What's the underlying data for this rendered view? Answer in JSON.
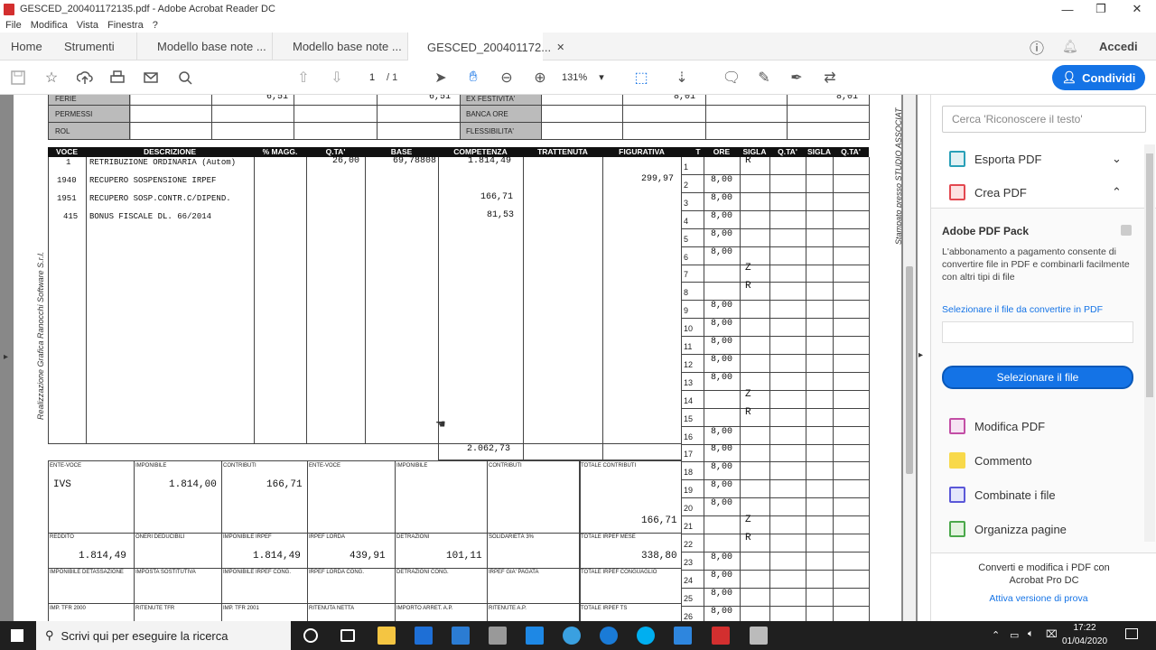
{
  "window": {
    "title": "GESCED_200401172135.pdf - Adobe Acrobat Reader DC"
  },
  "menu": [
    "File",
    "Modifica",
    "Vista",
    "Finestra",
    "?"
  ],
  "tabs": {
    "home": "Home",
    "tools": "Strumenti",
    "docs": [
      "Modello base note ...",
      "Modello base note ...",
      "GESCED_200401172..."
    ],
    "signin": "Accedi"
  },
  "toolbar": {
    "page_current": "1",
    "page_total": "/ 1",
    "zoom": "131%",
    "share": "Condividi"
  },
  "payslip": {
    "top_rows": [
      {
        "label": "FERIE",
        "v1": "6,51",
        "v2": "6,51",
        "label2": "EX FESTIVITA'",
        "v3": "8,01",
        "v4": "8,01"
      },
      {
        "label": "PERMESSI",
        "v1": "",
        "v2": "",
        "label2": "BANCA ORE",
        "v3": "",
        "v4": ""
      },
      {
        "label": "ROL",
        "v1": "",
        "v2": "",
        "label2": "FLESSIBILITA'",
        "v3": "",
        "v4": ""
      }
    ],
    "headers": {
      "voce": "VOCE",
      "descrizione": "DESCRIZIONE",
      "magg": "% MAGG.",
      "qta": "Q.TA'",
      "base": "BASE",
      "competenza": "COMPETENZA",
      "trattenuta": "TRATTENUTA",
      "figurativa": "FIGURATIVA",
      "t": "T",
      "ore": "ORE",
      "sigla": "SIGLA",
      "qta2": "Q.TA'",
      "sigla2": "SIGLA",
      "qta3": "Q.TA'"
    },
    "items": [
      {
        "voce": "1",
        "desc": "RETRIBUZIONE ORDINARIA (Autom)",
        "qta": "26,00",
        "base": "69,78808",
        "comp": "1.814,49",
        "fig": ""
      },
      {
        "voce": "1940",
        "desc": "RECUPERO SOSPENSIONE IRPEF",
        "qta": "",
        "base": "",
        "comp": "",
        "fig": "299,97"
      },
      {
        "voce": "1951",
        "desc": "RECUPERO SOSP.CONTR.C/DIPEND.",
        "qta": "",
        "base": "",
        "comp": "166,71",
        "fig": ""
      },
      {
        "voce": "415",
        "desc": "BONUS FISCALE DL. 66/2014",
        "qta": "",
        "base": "",
        "comp": "81,53",
        "fig": ""
      }
    ],
    "total_competenze": "2.062,73",
    "days": [
      {
        "d": "1",
        "ore": "",
        "sigla": "R"
      },
      {
        "d": "2",
        "ore": "8,00",
        "sigla": ""
      },
      {
        "d": "3",
        "ore": "8,00",
        "sigla": ""
      },
      {
        "d": "4",
        "ore": "8,00",
        "sigla": ""
      },
      {
        "d": "5",
        "ore": "8,00",
        "sigla": ""
      },
      {
        "d": "6",
        "ore": "8,00",
        "sigla": ""
      },
      {
        "d": "7",
        "ore": "",
        "sigla": "Z"
      },
      {
        "d": "8",
        "ore": "",
        "sigla": "R"
      },
      {
        "d": "9",
        "ore": "8,00",
        "sigla": ""
      },
      {
        "d": "10",
        "ore": "8,00",
        "sigla": ""
      },
      {
        "d": "11",
        "ore": "8,00",
        "sigla": ""
      },
      {
        "d": "12",
        "ore": "8,00",
        "sigla": ""
      },
      {
        "d": "13",
        "ore": "8,00",
        "sigla": ""
      },
      {
        "d": "14",
        "ore": "",
        "sigla": "Z"
      },
      {
        "d": "15",
        "ore": "",
        "sigla": "R"
      },
      {
        "d": "16",
        "ore": "8,00",
        "sigla": ""
      },
      {
        "d": "17",
        "ore": "8,00",
        "sigla": ""
      },
      {
        "d": "18",
        "ore": "8,00",
        "sigla": ""
      },
      {
        "d": "19",
        "ore": "8,00",
        "sigla": ""
      },
      {
        "d": "20",
        "ore": "8,00",
        "sigla": ""
      },
      {
        "d": "21",
        "ore": "",
        "sigla": "Z"
      },
      {
        "d": "22",
        "ore": "",
        "sigla": "R"
      },
      {
        "d": "23",
        "ore": "8,00",
        "sigla": ""
      },
      {
        "d": "24",
        "ore": "8,00",
        "sigla": ""
      },
      {
        "d": "25",
        "ore": "8,00",
        "sigla": ""
      },
      {
        "d": "26",
        "ore": "8,00",
        "sigla": ""
      }
    ],
    "contrib": {
      "l_ente1": "ENTE-VOCE",
      "l_imp1": "IMPONIBILE",
      "l_contr1": "CONTRIBUTI",
      "l_ente2": "ENTE-VOCE",
      "l_imp2": "IMPONIBILE",
      "l_contr2": "CONTRIBUTI",
      "l_tot": "TOTALE CONTRIBUTI",
      "ente1": "IVS",
      "imp1": "1.814,00",
      "contr1": "166,71",
      "tot": "166,71",
      "l_reddito": "REDDITO",
      "l_oneri": "ONERI DEDUCIBILI",
      "l_impirpef": "IMPONIBILE IRPEF",
      "l_lorda": "IRPEF LORDA",
      "l_detr": "DETRAZIONI",
      "l_sol": "SOLIDARIETÀ 3%",
      "l_totirpef": "TOTALE IRPEF MESE",
      "reddito": "1.814,49",
      "impirpef": "1.814,49",
      "lorda": "439,91",
      "detr": "101,11",
      "totirpef": "338,80",
      "l_r3": [
        "IMPONIBILE DETASSAZIONE",
        "IMPOSTA SOSTITUTIVA",
        "IMPONIBILE IRPEF CONG.",
        "IRPEF LORDA CONG.",
        "DETRAZIONI CONG.",
        "IRPEF GIA' PAGATA",
        "TOTALE IRPEF CONGUAGLIO"
      ],
      "l_r4": [
        "IMP. TFR 2000",
        "RITENUTE TFR",
        "IMP. TFR 2001",
        "RITENUTA NETTA",
        "IMPORTO ARRET. A.P.",
        "RITENUTE A.P.",
        "TOTALE IRPEF TS"
      ]
    },
    "side_left": "Realizzazione Grafica Ranocchi Software S.r.l.",
    "side_right": "Stampato presso STUDIO ASSOCIAT"
  },
  "panel": {
    "search": "Cerca 'Riconoscere il testo'",
    "export": "Esporta PDF",
    "create": "Crea PDF",
    "pack_title": "Adobe PDF Pack",
    "pack_desc": "L'abbonamento a pagamento consente di convertire file in PDF e combinarli facilmente con altri tipi di file",
    "select_label": "Selezionare il file da convertire in PDF",
    "select_btn": "Selezionare il file",
    "edit": "Modifica PDF",
    "comment": "Commento",
    "combine": "Combinate i file",
    "organize": "Organizza pagine",
    "promo": "Converti e modifica i PDF con Acrobat Pro DC",
    "trial": "Attiva versione di prova"
  },
  "taskbar": {
    "search": "Scrivi qui per eseguire la ricerca",
    "time": "17:22",
    "date": "01/04/2020"
  }
}
